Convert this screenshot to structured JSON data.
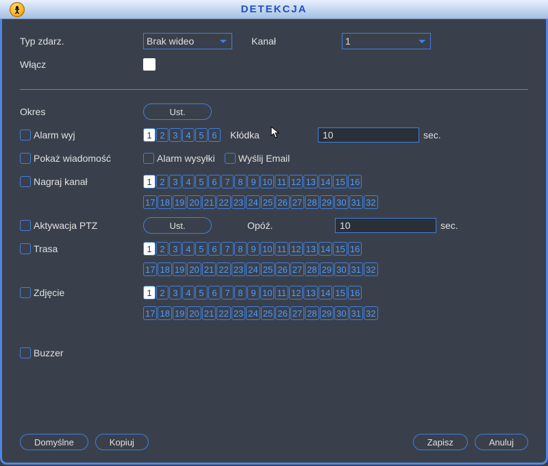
{
  "window_title": "DETEKCJA",
  "labels": {
    "event_type": "Typ zdarz.",
    "channel": "Kanał",
    "enable": "Włącz",
    "period": "Okres",
    "alarm_out": "Alarm wyj",
    "latch": "Kłódka",
    "sec": "sec.",
    "show_msg": "Pokaż wiadomość",
    "alarm_upload": "Alarm wysyłki",
    "send_email": "Wyślij Email",
    "record_ch": "Nagraj kanał",
    "ptz_act": "Aktywacja PTZ",
    "delay": "Opóź.",
    "tour": "Trasa",
    "snapshot": "Zdjęcie",
    "buzzer": "Buzzer"
  },
  "buttons": {
    "set": "Ust.",
    "default": "Domyślne",
    "copy": "Kopiuj",
    "save": "Zapisz",
    "cancel": "Anuluj"
  },
  "event_type_value": "Brak wideo",
  "channel_value": "1",
  "latch_value": "10",
  "delay_value": "10",
  "alarm_out_channels": 6,
  "grid_channels": 32,
  "selected_alarm_out": [
    1
  ],
  "selected_record": [
    1
  ],
  "selected_tour": [
    1
  ],
  "selected_snapshot": [
    1
  ]
}
